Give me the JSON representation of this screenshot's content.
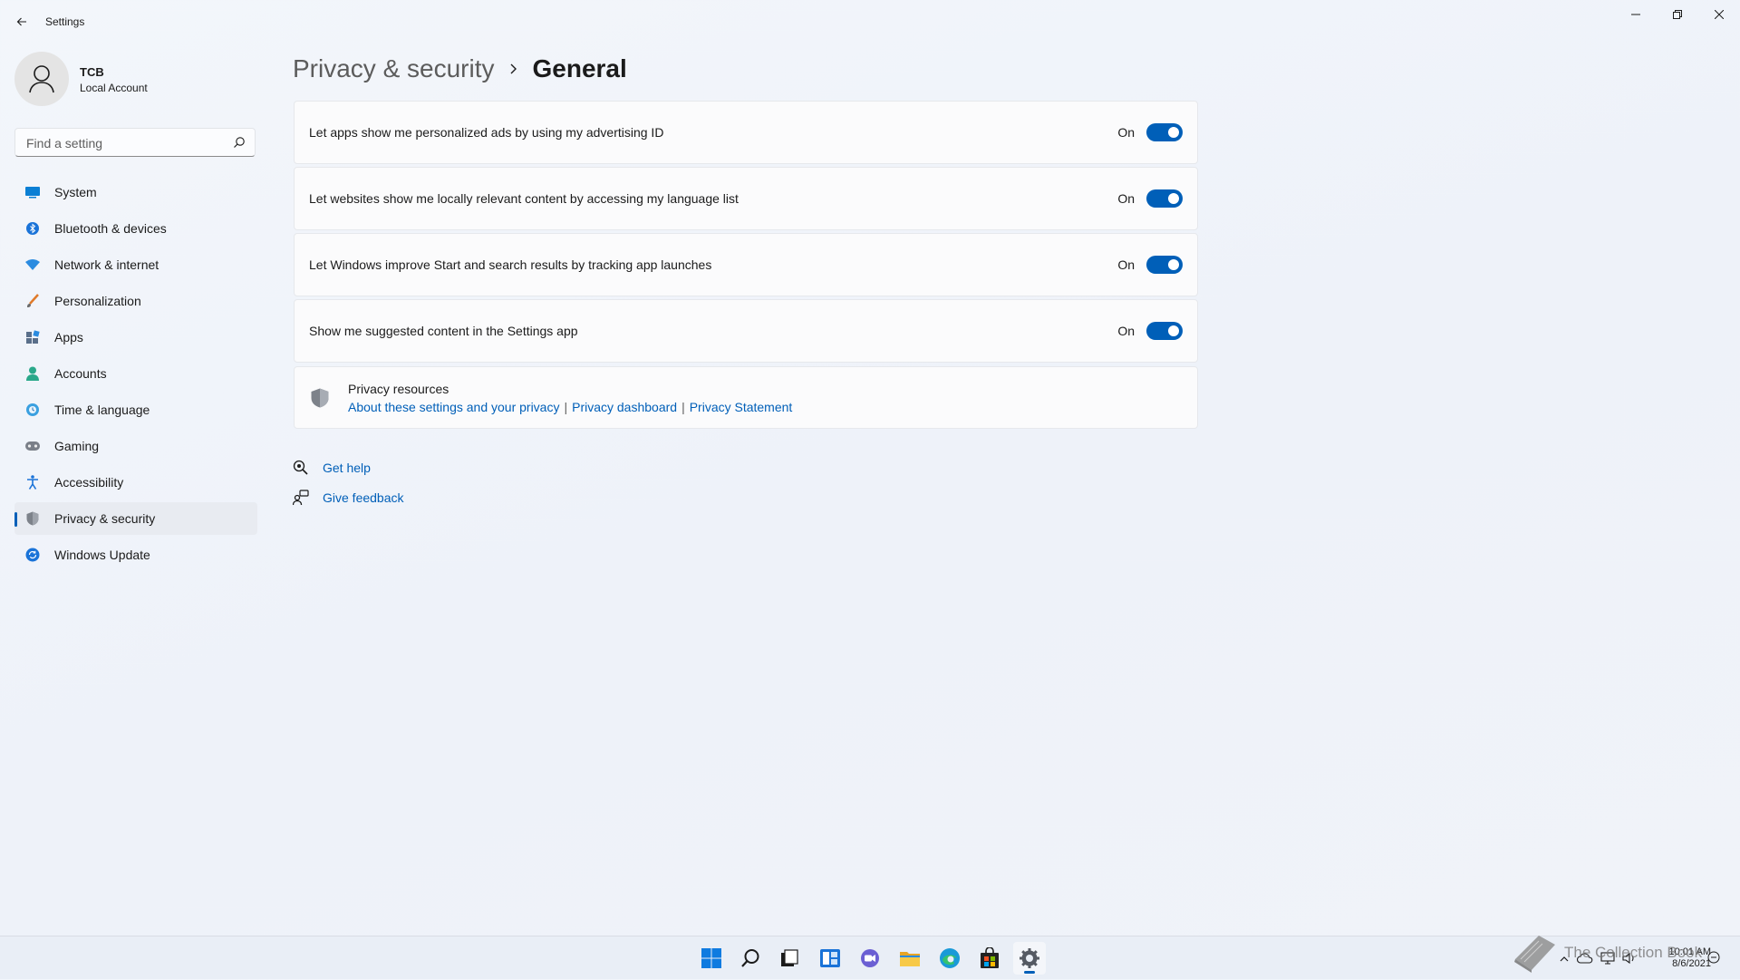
{
  "window": {
    "title": "Settings"
  },
  "profile": {
    "name": "TCB",
    "account_type": "Local Account"
  },
  "search": {
    "placeholder": "Find a setting"
  },
  "sidebar": {
    "items": [
      {
        "label": "System",
        "icon": "system-icon",
        "active": false
      },
      {
        "label": "Bluetooth & devices",
        "icon": "bluetooth-icon",
        "active": false
      },
      {
        "label": "Network & internet",
        "icon": "network-icon",
        "active": false
      },
      {
        "label": "Personalization",
        "icon": "personalization-icon",
        "active": false
      },
      {
        "label": "Apps",
        "icon": "apps-icon",
        "active": false
      },
      {
        "label": "Accounts",
        "icon": "accounts-icon",
        "active": false
      },
      {
        "label": "Time & language",
        "icon": "time-language-icon",
        "active": false
      },
      {
        "label": "Gaming",
        "icon": "gaming-icon",
        "active": false
      },
      {
        "label": "Accessibility",
        "icon": "accessibility-icon",
        "active": false
      },
      {
        "label": "Privacy & security",
        "icon": "privacy-shield-icon",
        "active": true
      },
      {
        "label": "Windows Update",
        "icon": "windows-update-icon",
        "active": false
      }
    ]
  },
  "breadcrumb": {
    "parent": "Privacy & security",
    "current": "General"
  },
  "settings": [
    {
      "label": "Let apps show me personalized ads by using my advertising ID",
      "state": "On",
      "enabled": true
    },
    {
      "label": "Let websites show me locally relevant content by accessing my language list",
      "state": "On",
      "enabled": true
    },
    {
      "label": "Let Windows improve Start and search results by tracking app launches",
      "state": "On",
      "enabled": true
    },
    {
      "label": "Show me suggested content in the Settings app",
      "state": "On",
      "enabled": true
    }
  ],
  "resources": {
    "title": "Privacy resources",
    "links": [
      "About these settings and your privacy",
      "Privacy dashboard",
      "Privacy Statement"
    ]
  },
  "help": {
    "get_help": "Get help",
    "give_feedback": "Give feedback"
  },
  "taskbar": {
    "apps": [
      "start-icon",
      "search-icon",
      "task-view-icon",
      "widgets-icon",
      "chat-icon",
      "file-explorer-icon",
      "edge-icon",
      "store-icon",
      "settings-icon"
    ],
    "active_app": "settings-icon"
  },
  "clock": {
    "time": "10:01 AM",
    "date": "8/6/2021"
  },
  "watermark": {
    "text": "The Collection Book"
  },
  "colors": {
    "accent": "#005fb8",
    "background": "#f3f6fb"
  }
}
